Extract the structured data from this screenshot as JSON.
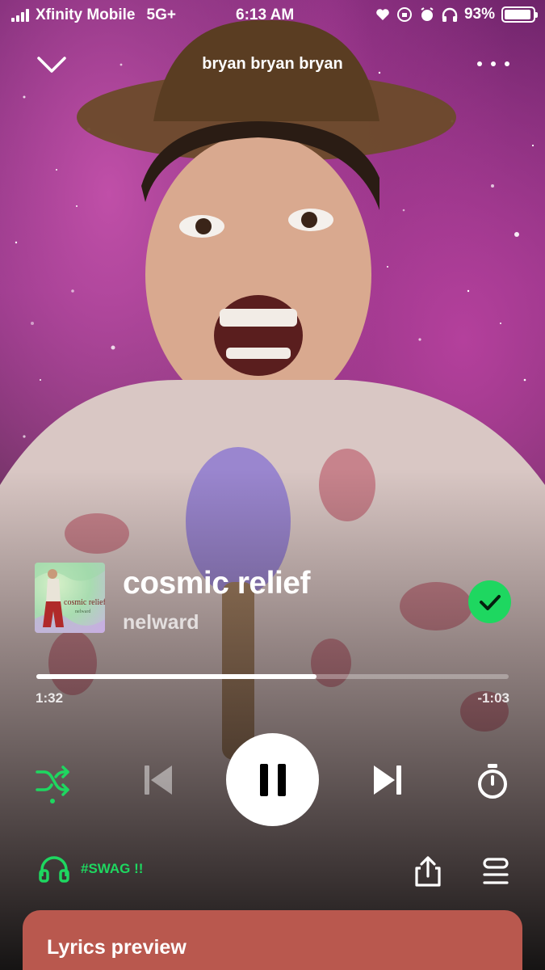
{
  "status_bar": {
    "carrier": "Xfinity Mobile",
    "network": "5G+",
    "time": "6:13 AM",
    "battery": "93%",
    "battery_level": 0.93
  },
  "header": {
    "title": "bryan bryan bryan"
  },
  "track": {
    "title": "cosmic relief",
    "artist": "nelward",
    "cover_caption": "cosmic relief",
    "cover_subcaption": "nelward",
    "liked": true
  },
  "progress": {
    "elapsed": "1:32",
    "remaining": "-1:03",
    "fraction": 0.594
  },
  "controls": {
    "shuffle": "shuffle-icon",
    "previous": "skip-previous-icon",
    "play_state": "pause-icon",
    "next": "skip-next-icon",
    "sleep_timer": "timer-icon"
  },
  "device": {
    "label": "#SWAG !!"
  },
  "lyrics": {
    "title": "Lyrics preview"
  },
  "colors": {
    "accent_green": "#1ed760",
    "lyrics_card": "#b9584e"
  }
}
